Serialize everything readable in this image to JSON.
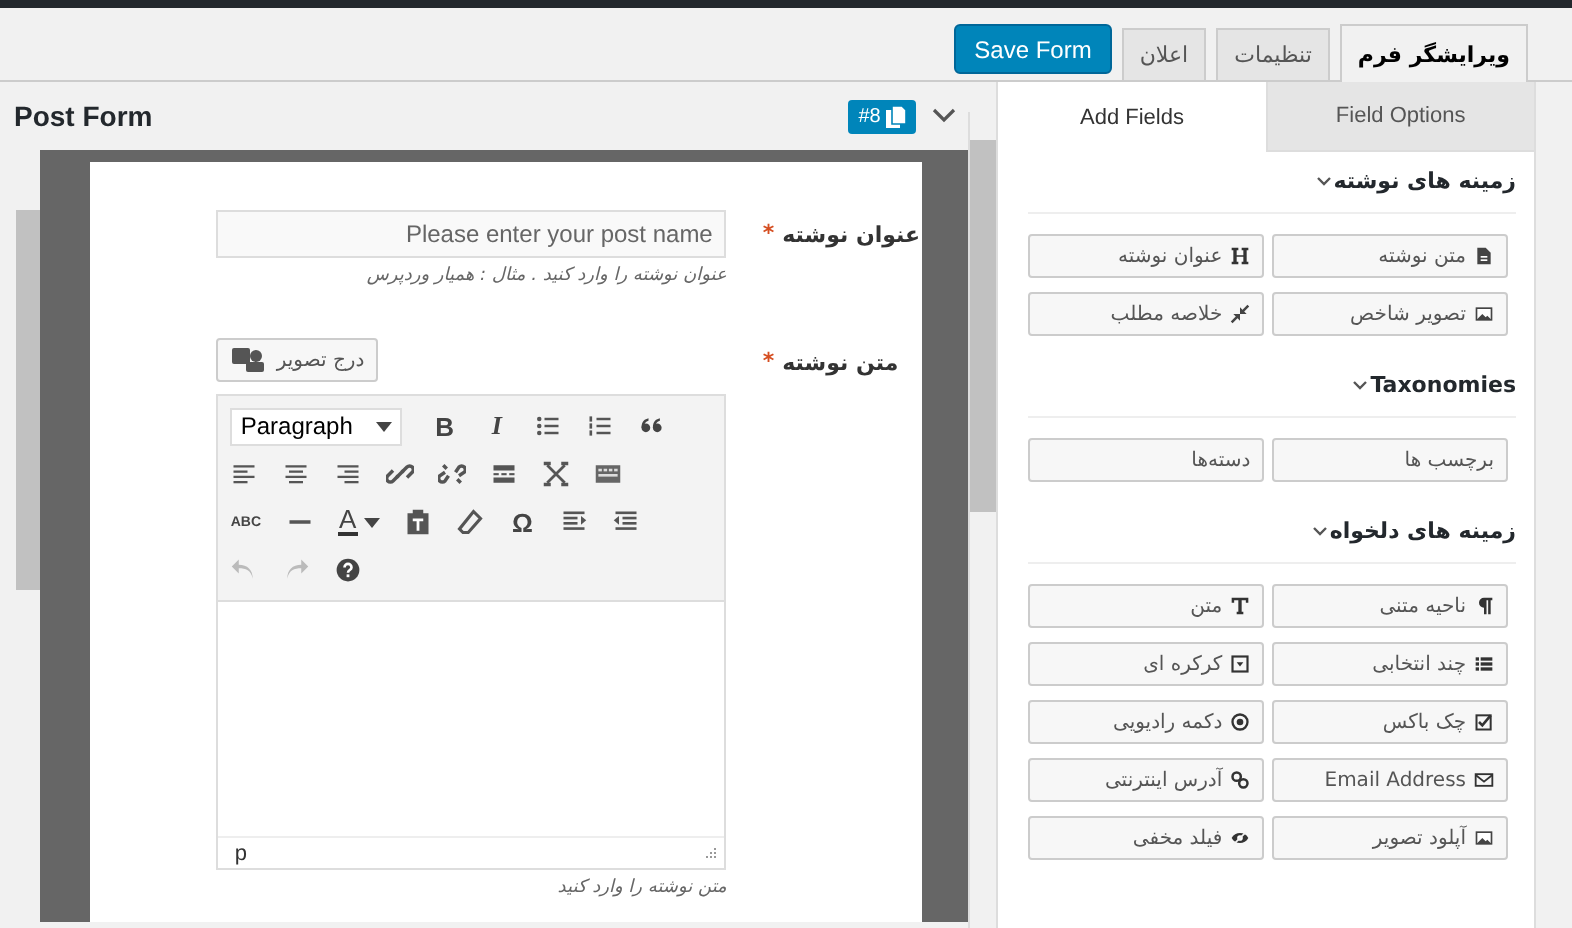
{
  "top_tabs": [
    {
      "label": "ویرایشگر فرم",
      "selected": true
    },
    {
      "label": "تنظیمات",
      "selected": false
    },
    {
      "label": "اعلان",
      "selected": false
    }
  ],
  "save_button": "Save Form",
  "form_title": "Post Form",
  "form_id_badge": "#8",
  "form_fields": [
    {
      "label": "عنوان نوشته",
      "required_mark": "*",
      "placeholder": "Please enter your post name",
      "help": "عنوان نوشته را وارد کنید . مثال : همیار وردپرس"
    },
    {
      "label": "متن نوشته",
      "required_mark": "*",
      "insert_image": "درج تصویر",
      "help": "متن نوشته را وارد کنید"
    }
  ],
  "editor": {
    "format": "Paragraph",
    "bold": "B",
    "italic": "I",
    "strikethrough": "ABC",
    "text_color": "A",
    "special_char": "Ω",
    "undo_disabled": true,
    "redo_disabled": true,
    "path": "p"
  },
  "panel_tabs": [
    {
      "label": "Field Options",
      "selected": false
    },
    {
      "label": "Add Fields",
      "selected": true
    }
  ],
  "sections": [
    {
      "title": "زمینه های نوشته",
      "expanded": true,
      "buttons": [
        "متن نوشته",
        "عنوان نوشته",
        "تصویر شاخص",
        "خلاصه مطلب"
      ]
    },
    {
      "title": "Taxonomies",
      "expanded": true,
      "buttons": [
        "برچسب ها",
        "دسته‌ها"
      ]
    },
    {
      "title": "زمینه های دلخواه",
      "expanded": true,
      "buttons": [
        "ناحیه متنی",
        "متن",
        "چند انتخابی",
        "کرکره ای",
        "چک باکس",
        "دکمه رادیویی",
        "Email Address",
        "آدرس اینترنتی",
        "آپلود تصویر",
        "فیلد مخفی"
      ]
    }
  ]
}
